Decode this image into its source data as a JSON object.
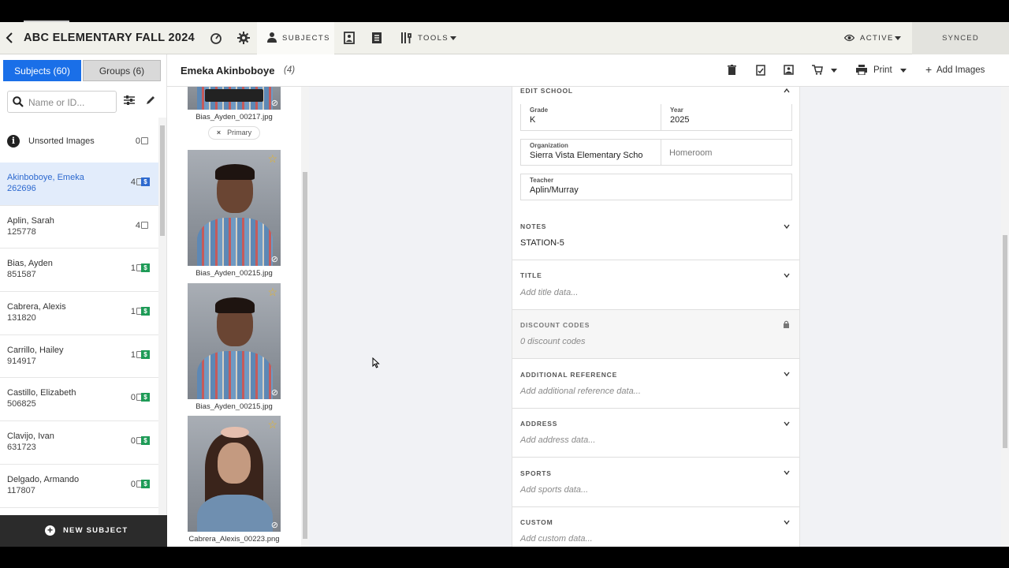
{
  "header": {
    "title": "ABC ELEMENTARY FALL 2024",
    "subjects_tab": "SUBJECTS",
    "tools": "TOOLS",
    "active": "ACTIVE",
    "synced": "SYNCED"
  },
  "sidebar": {
    "tab_subjects": "Subjects (60)",
    "tab_groups": "Groups (6)",
    "search_placeholder": "Name or ID...",
    "unsorted_label": "Unsorted Images",
    "unsorted_count": "0",
    "items": [
      {
        "name": "Akinboboye, Emeka",
        "id": "262696",
        "count": "4",
        "paid": true
      },
      {
        "name": "Aplin, Sarah",
        "id": "125778",
        "count": "4",
        "paid": false
      },
      {
        "name": "Bias, Ayden",
        "id": "851587",
        "count": "1",
        "paid": true
      },
      {
        "name": "Cabrera, Alexis",
        "id": "131820",
        "count": "1",
        "paid": true
      },
      {
        "name": "Carrillo, Hailey",
        "id": "914917",
        "count": "1",
        "paid": true
      },
      {
        "name": "Castillo, Elizabeth",
        "id": "506825",
        "count": "0",
        "paid": true
      },
      {
        "name": "Clavijo, Ivan",
        "id": "631723",
        "count": "0",
        "paid": true
      },
      {
        "name": "Delgado, Armando",
        "id": "117807",
        "count": "0",
        "paid": true
      }
    ],
    "new_subject": "NEW SUBJECT"
  },
  "subject": {
    "name": "Emeka Akinboboye",
    "count": "(4)",
    "print": "Print",
    "add_images": "Add Images"
  },
  "images": [
    {
      "filename": "Bias_Ayden_00217.jpg",
      "primary": "Primary"
    },
    {
      "filename": "Bias_Ayden_00215.jpg"
    },
    {
      "filename": "Bias_Ayden_00215.jpg"
    },
    {
      "filename": "Cabrera_Alexis_00223.png"
    }
  ],
  "details": {
    "edit_school": "EDIT SCHOOL",
    "grade_label": "Grade",
    "grade_value": "K",
    "year_label": "Year",
    "year_value": "2025",
    "org_label": "Organization",
    "org_value": "Sierra Vista Elementary Scho",
    "homeroom_placeholder": "Homeroom",
    "teacher_label": "Teacher",
    "teacher_value": "Aplin/Murray",
    "notes_title": "NOTES",
    "notes_value": "STATION-5",
    "title_title": "TITLE",
    "title_ph": "Add title data...",
    "discount_title": "DISCOUNT CODES",
    "discount_ph": "0 discount codes",
    "addref_title": "ADDITIONAL REFERENCE",
    "addref_ph": "Add additional reference data...",
    "address_title": "ADDRESS",
    "address_ph": "Add address data...",
    "sports_title": "SPORTS",
    "sports_ph": "Add sports data...",
    "custom_title": "CUSTOM",
    "custom_ph": "Add custom data..."
  },
  "colors": {
    "accent": "#1a6fe8",
    "paid_green": "#1e9b57",
    "star": "#e6b325"
  }
}
